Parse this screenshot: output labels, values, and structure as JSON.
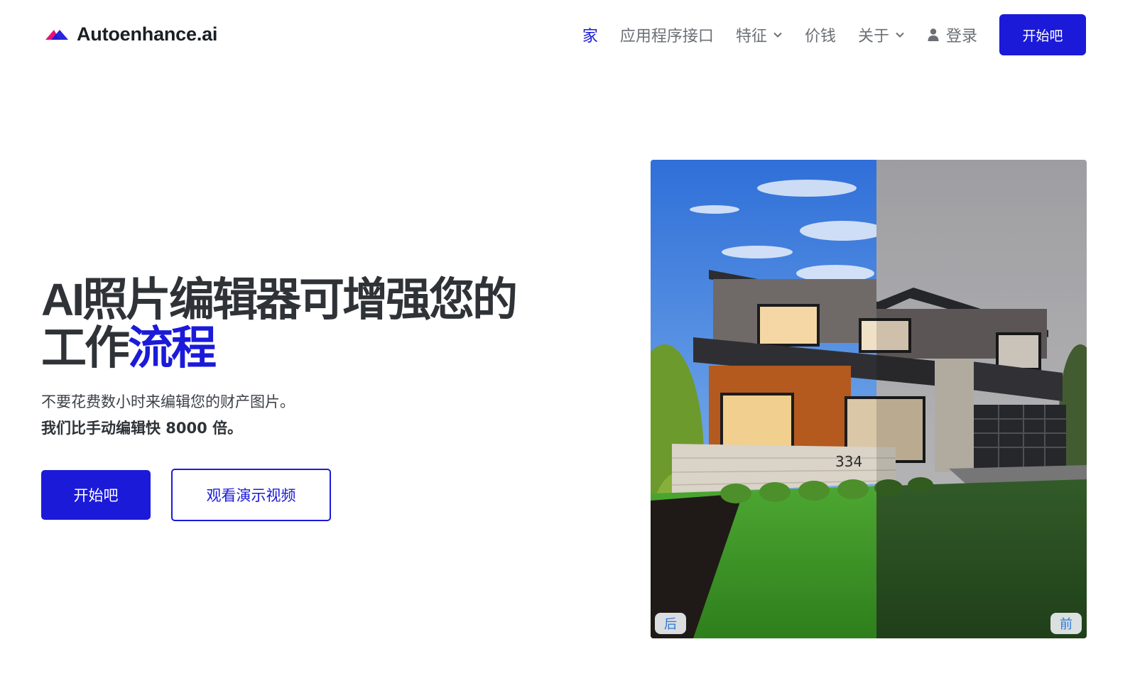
{
  "brand": {
    "name": "Autoenhance.ai",
    "logo_colors": {
      "left": "#e3127a",
      "right": "#1b1ad9"
    }
  },
  "nav": {
    "home": "家",
    "api": "应用程序接口",
    "features": "特征",
    "pricing": "价钱",
    "about": "关于",
    "login": "登录",
    "cta": "开始吧"
  },
  "hero": {
    "title_main": "AI照片编辑器可增强您的工作",
    "title_accent": "流程",
    "subtitle": "不要花费数小时来编辑您的财产图片。",
    "subtitle_bold": "我们比手动编辑快 8000 倍。",
    "primary_button": "开始吧",
    "secondary_button": "观看演示视频"
  },
  "comparison": {
    "after_label": "后",
    "before_label": "前",
    "house_number": "334"
  },
  "colors": {
    "accent": "#1b1ad9",
    "heading": "#2f3337",
    "nav_text": "#6b6f75",
    "label_text": "#2b78d6"
  }
}
